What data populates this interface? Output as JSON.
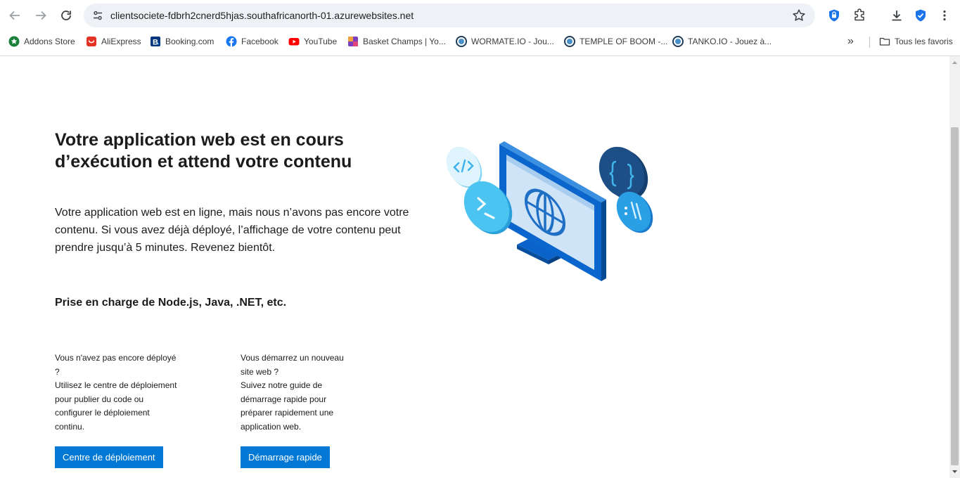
{
  "browser": {
    "url": "clientsociete-fdbrh2cnerd5hjas.southafricanorth-01.azurewebsites.net",
    "bookmarks": [
      {
        "label": "Addons Store",
        "icon": "addons-store-icon",
        "color": "#1a7f37"
      },
      {
        "label": "AliExpress",
        "icon": "aliexpress-icon",
        "color": "#e43225"
      },
      {
        "label": "Booking.com",
        "icon": "booking-icon",
        "color": "#003580"
      },
      {
        "label": "Facebook",
        "icon": "facebook-icon",
        "color": "#1877f2"
      },
      {
        "label": "YouTube",
        "icon": "youtube-icon",
        "color": "#ff0000"
      },
      {
        "label": "Basket Champs | Yo...",
        "icon": "basket-champs-icon",
        "color": "#7b3fbf"
      },
      {
        "label": "WORMATE.IO - Jou...",
        "icon": "wormate-icon",
        "color": "#1f3b57"
      },
      {
        "label": "TEMPLE OF BOOM -...",
        "icon": "temple-of-boom-icon",
        "color": "#1f3b57"
      },
      {
        "label": "TANKO.IO - Jouez à...",
        "icon": "tanko-icon",
        "color": "#1f3b57"
      }
    ],
    "more_label": "»",
    "all_bookmarks_label": "Tous les favoris"
  },
  "page": {
    "headline": "Votre application web est en cours d’exécution et attend votre contenu",
    "lead": "Votre application web est en ligne, mais nous n’avons pas encore votre contenu. Si vous avez déjà déployé, l’affichage de votre contenu peut prendre jusqu’à 5 minutes. Revenez bientôt.",
    "support": "Prise en charge de Node.js, Java, .NET, etc.",
    "deploy_col": {
      "question": "Vous n'avez pas encore déployé ?",
      "text": "Utilisez le centre de déploiement pour publier du code ou configurer le déploiement continu.",
      "button": "Centre de déploiement"
    },
    "quickstart_col": {
      "question": "Vous démarrez un nouveau site web ?",
      "text": "Suivez notre guide de démarrage rapide pour préparer rapidement une application web.",
      "button": "Démarrage rapide"
    }
  },
  "colors": {
    "accent": "#0078d4",
    "monitor_dark": "#0a5db8",
    "bubble_light": "#50c4f2",
    "bubble_dark": "#1a4d8c"
  }
}
